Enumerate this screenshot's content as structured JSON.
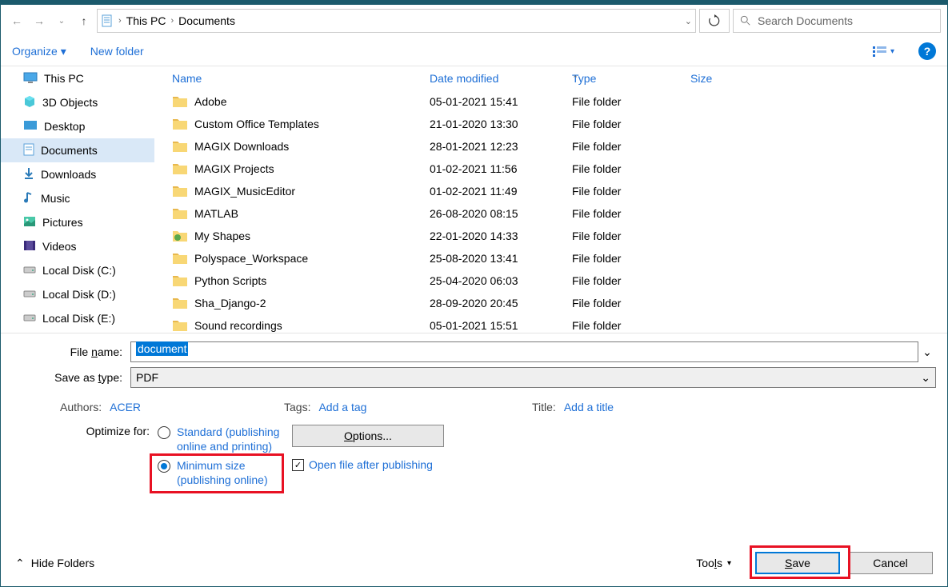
{
  "breadcrumb": {
    "root": "This PC",
    "current": "Documents"
  },
  "search": {
    "placeholder": "Search Documents"
  },
  "cmdbar": {
    "organize": "Organize",
    "newfolder": "New folder"
  },
  "nav": [
    {
      "label": "This PC",
      "icon": "pc"
    },
    {
      "label": "3D Objects",
      "icon": "3d"
    },
    {
      "label": "Desktop",
      "icon": "desktop"
    },
    {
      "label": "Documents",
      "icon": "docs",
      "selected": true
    },
    {
      "label": "Downloads",
      "icon": "down"
    },
    {
      "label": "Music",
      "icon": "music"
    },
    {
      "label": "Pictures",
      "icon": "pics"
    },
    {
      "label": "Videos",
      "icon": "vids"
    },
    {
      "label": "Local Disk (C:)",
      "icon": "disk"
    },
    {
      "label": "Local Disk (D:)",
      "icon": "disk"
    },
    {
      "label": "Local Disk (E:)",
      "icon": "disk"
    }
  ],
  "columns": {
    "name": "Name",
    "date": "Date modified",
    "type": "Type",
    "size": "Size"
  },
  "files": [
    {
      "name": "Adobe",
      "date": "05-01-2021 15:41",
      "type": "File folder"
    },
    {
      "name": "Custom Office Templates",
      "date": "21-01-2020 13:30",
      "type": "File folder"
    },
    {
      "name": "MAGIX Downloads",
      "date": "28-01-2021 12:23",
      "type": "File folder"
    },
    {
      "name": "MAGIX Projects",
      "date": "01-02-2021 11:56",
      "type": "File folder"
    },
    {
      "name": "MAGIX_MusicEditor",
      "date": "01-02-2021 11:49",
      "type": "File folder"
    },
    {
      "name": "MATLAB",
      "date": "26-08-2020 08:15",
      "type": "File folder"
    },
    {
      "name": "My Shapes",
      "date": "22-01-2020 14:33",
      "type": "File folder",
      "special": true
    },
    {
      "name": "Polyspace_Workspace",
      "date": "25-08-2020 13:41",
      "type": "File folder"
    },
    {
      "name": "Python Scripts",
      "date": "25-04-2020 06:03",
      "type": "File folder"
    },
    {
      "name": "Sha_Django-2",
      "date": "28-09-2020 20:45",
      "type": "File folder"
    },
    {
      "name": "Sound recordings",
      "date": "05-01-2021 15:51",
      "type": "File folder"
    }
  ],
  "form": {
    "fnlabel": "File name:",
    "fnvalue": "document",
    "typelabel": "Save as type:",
    "typevalue": "PDF"
  },
  "meta": {
    "authorslabel": "Authors:",
    "authorsval": "ACER",
    "tagslabel": "Tags:",
    "tagsval": "Add a tag",
    "titlelabel": "Title:",
    "titleval": "Add a title"
  },
  "optimize": {
    "label": "Optimize for:",
    "std": "Standard (publishing online and printing)",
    "min": "Minimum size (publishing online)",
    "optionsbtn": "Options...",
    "openafter": "Open file after publishing"
  },
  "footer": {
    "hide": "Hide Folders",
    "tools": "Tools",
    "save": "Save",
    "cancel": "Cancel"
  }
}
